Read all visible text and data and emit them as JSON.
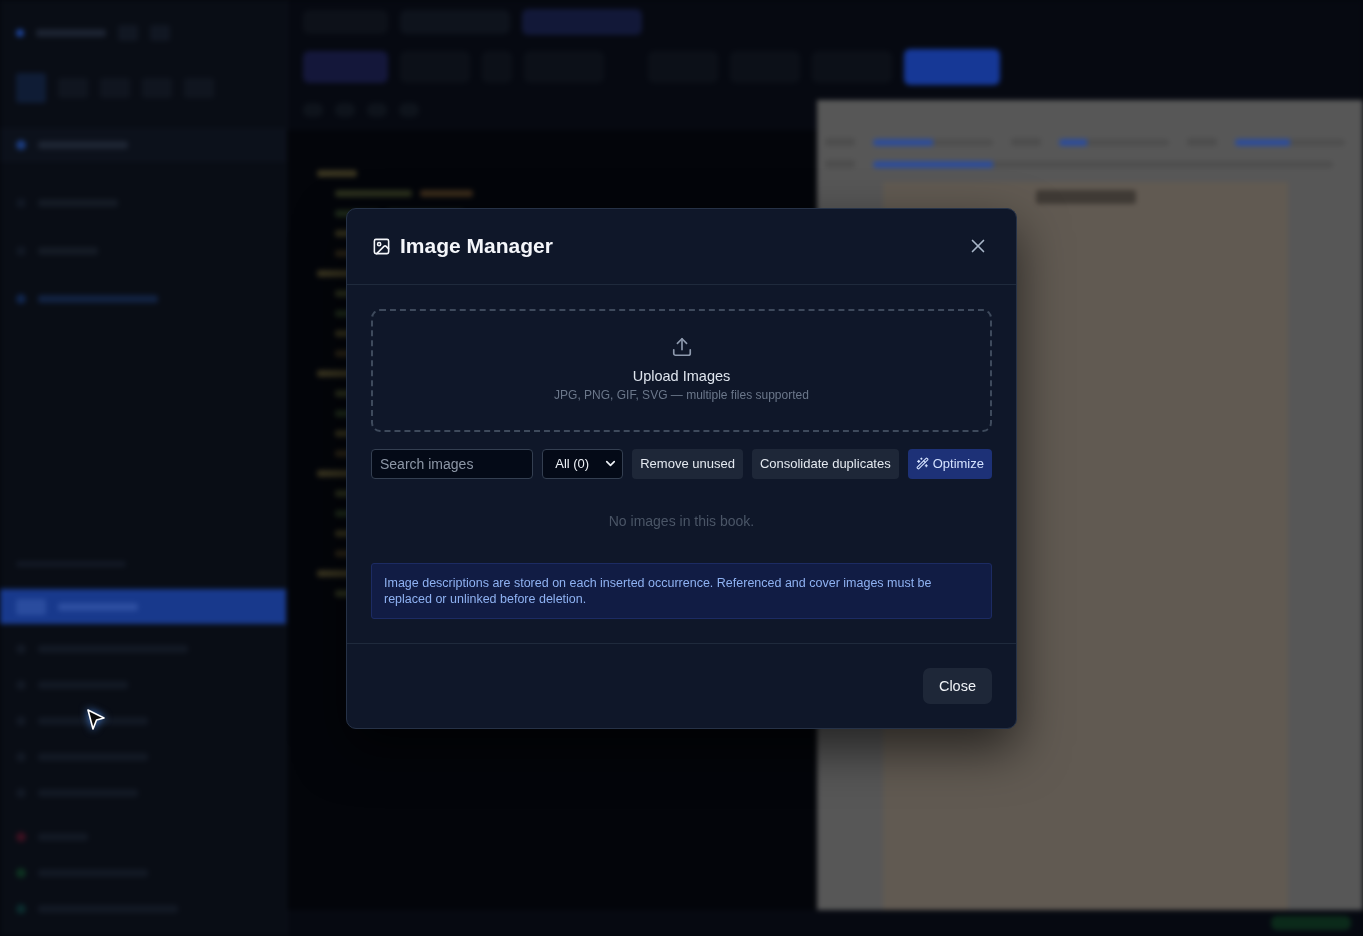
{
  "dialog": {
    "title": "Image Manager",
    "upload": {
      "title": "Upload Images",
      "hint": "JPG, PNG, GIF, SVG — multiple files supported"
    },
    "toolbar": {
      "search": {
        "placeholder": "Search images"
      },
      "filter": {
        "value": "All (0)"
      },
      "buttons": [
        {
          "label": "Remove unused",
          "kind": "secondary"
        },
        {
          "label": "Consolidate duplicates",
          "kind": "secondary"
        },
        {
          "label": "Optimize",
          "kind": "primary"
        }
      ]
    },
    "empty_message": "No images in this book.",
    "notice": "Image descriptions are stored on each inserted occurrence. Referenced and cover images must be replaced or unlinked before deletion.",
    "footer": {
      "buttons": [
        {
          "label": "Close"
        }
      ]
    }
  }
}
